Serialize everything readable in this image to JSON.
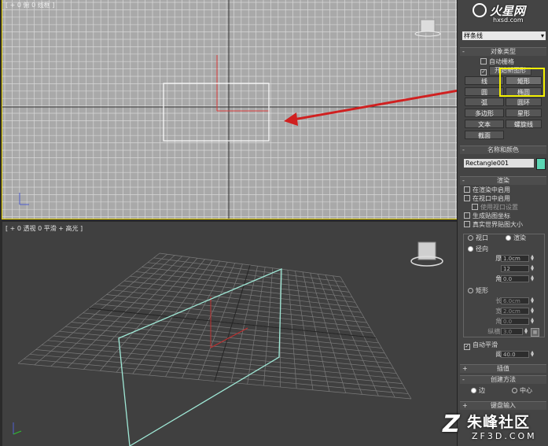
{
  "viewport_top": {
    "label": "[ + 0 俯 0 线框 ]"
  },
  "viewport_persp": {
    "label": "[ + 0 透视 0 平滑 + 高光 ]"
  },
  "watermark_top": {
    "text": "火星网",
    "url": "hxsd.com"
  },
  "watermark_bottom": {
    "text": "朱峰社区",
    "url": "ZF3D.COM"
  },
  "panel": {
    "category_dropdown": "样条线",
    "object_type": {
      "title": "对象类型",
      "auto_grid": "自动栅格",
      "start_new_shape": "开始新图形",
      "buttons": [
        "线",
        "矩形",
        "圆",
        "椭圆",
        "弧",
        "圆环",
        "多边形",
        "星形",
        "文本",
        "螺旋线",
        "截面"
      ]
    },
    "name_color": {
      "title": "名称和颜色",
      "name": "Rectangle001",
      "color": "#5cd6b4"
    },
    "rendering": {
      "title": "渲染",
      "enable_render": "在渲染中启用",
      "enable_viewport": "在视口中启用",
      "use_viewport_settings": "使用视口设置",
      "gen_mapping": "生成贴图坐标",
      "real_world": "真实世界贴图大小",
      "viewport_radio": "视口",
      "render_radio": "渲染",
      "radial": "径向",
      "thickness_label": "厚度:",
      "thickness": "1.0cm",
      "sides_label": "边:",
      "sides": "12",
      "angle_label": "角度:",
      "angle": "0.0",
      "rectangular": "矩形",
      "length_label": "长度:",
      "length": "6.0cm",
      "width_label": "宽度:",
      "width": "2.0cm",
      "angle2_label": "角度:",
      "angle2": "0.0",
      "aspect_label": "纵横比:",
      "aspect": "3.0",
      "auto_smooth": "自动平滑",
      "threshold_label": "阈值:",
      "threshold": "40.0"
    },
    "interpolation": {
      "title": "插值"
    },
    "creation_method": {
      "title": "创建方法",
      "edge": "边",
      "center": "中心"
    },
    "keyboard": {
      "title": "键盘输入"
    }
  }
}
